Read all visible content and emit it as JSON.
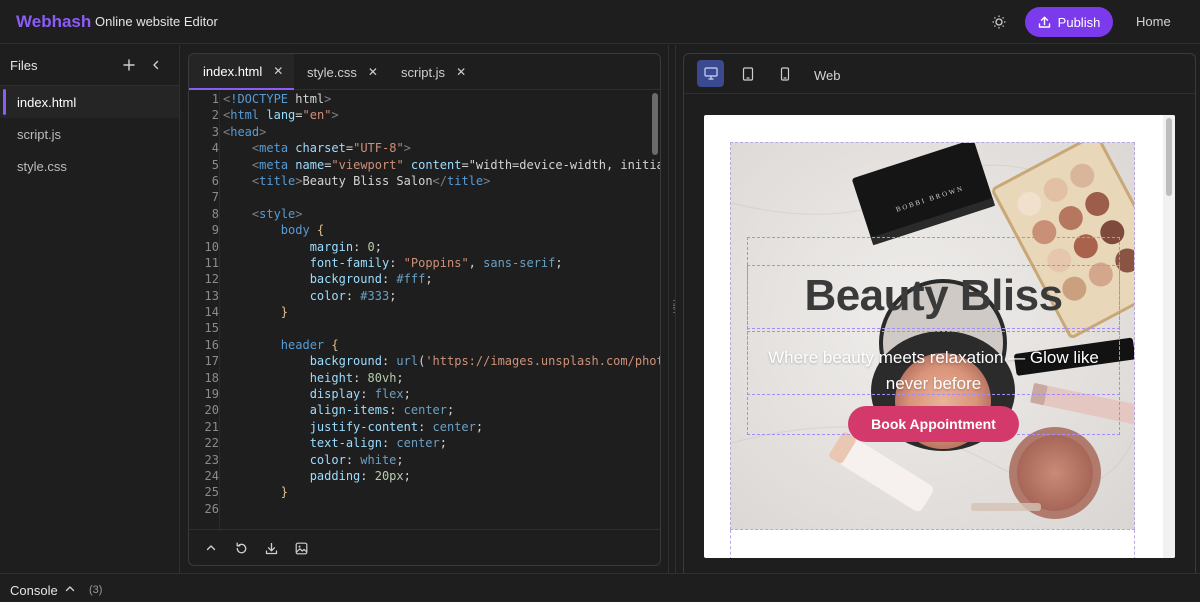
{
  "app": {
    "brand": "Webhash",
    "subtitle": "Online website Editor",
    "publish_label": "Publish",
    "home_label": "Home"
  },
  "files": {
    "title": "Files",
    "items": [
      {
        "name": "index.html",
        "active": true
      },
      {
        "name": "script.js",
        "active": false
      },
      {
        "name": "style.css",
        "active": false
      }
    ]
  },
  "editor": {
    "tabs": [
      {
        "label": "index.html",
        "active": true
      },
      {
        "label": "style.css",
        "active": false
      },
      {
        "label": "script.js",
        "active": false
      }
    ],
    "line_numbers": [
      "1",
      "2",
      "3",
      "4",
      "5",
      "6",
      "7",
      "8",
      "9",
      "10",
      "11",
      "12",
      "13",
      "14",
      "15",
      "16",
      "17",
      "18",
      "19",
      "20",
      "21",
      "22",
      "23",
      "24",
      "25",
      "26"
    ],
    "code_lines": [
      "<!DOCTYPE html>",
      "<html lang=\"en\">",
      "<head>",
      "    <meta charset=\"UTF-8\">",
      "    <meta name=\"viewport\" content=\"width=device-width, initia",
      "    <title>Beauty Bliss Salon</title>",
      "",
      "    <style>",
      "        body {",
      "            margin: 0;",
      "            font-family: \"Poppins\", sans-serif;",
      "            background: #fff;",
      "            color: #333;",
      "        }",
      "",
      "        header {",
      "            background: url('https://images.unsplash.com/phot",
      "            height: 80vh;",
      "            display: flex;",
      "            align-items: center;",
      "            justify-content: center;",
      "            text-align: center;",
      "            color: white;",
      "            padding: 20px;",
      "        }",
      ""
    ]
  },
  "preview": {
    "device_label": "Web",
    "hero_title": "Beauty Bliss",
    "hero_subtitle": "Where beauty meets relaxation — Glow like never before",
    "hero_button": "Book Appointment",
    "compact_brand": "BOBBI BROWN"
  },
  "console": {
    "label": "Console",
    "count": "(3)"
  },
  "colors": {
    "accent": "#7c3aed",
    "brand": "#8b5cf6",
    "hero_button": "#d33a6b",
    "background": "#1e1e1e"
  }
}
